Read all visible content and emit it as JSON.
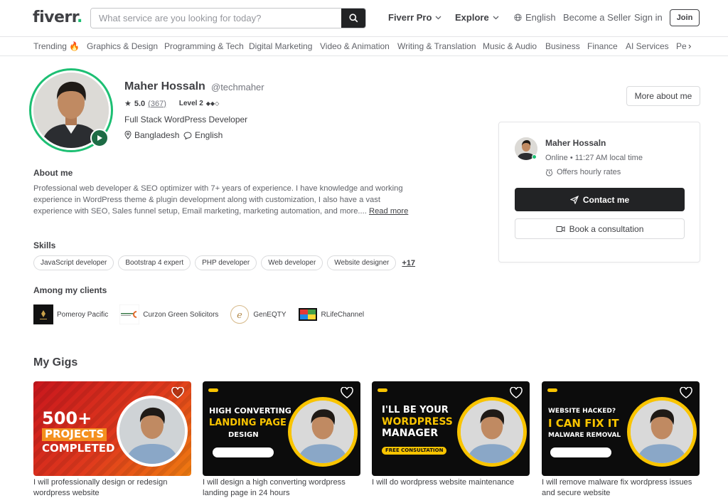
{
  "header": {
    "logo": "fiverr",
    "logo_dot": ".",
    "search_placeholder": "What service are you looking for today?",
    "fiverr_pro": "Fiverr Pro",
    "explore": "Explore",
    "language": "English",
    "become_seller": "Become a Seller",
    "sign_in": "Sign in",
    "join": "Join"
  },
  "categories": [
    "Trending 🔥",
    "Graphics & Design",
    "Programming & Tech",
    "Digital Marketing",
    "Video & Animation",
    "Writing & Translation",
    "Music & Audio",
    "Business",
    "Finance",
    "AI Services",
    "Personal Growth"
  ],
  "profile": {
    "name": "Maher Hossaln",
    "handle": "@techmaher",
    "rating": "5.0",
    "review_count": "(367)",
    "level": "Level 2",
    "level_diamonds": "◆◆◇",
    "title": "Full Stack WordPress Developer",
    "country": "Bangladesh",
    "language": "English",
    "more_about": "More about me"
  },
  "contact_card": {
    "name": "Maher Hossaln",
    "status": "Online • 11:27 AM local time",
    "hourly": "Offers hourly rates",
    "contact_btn": "Contact me",
    "consult_btn": "Book a consultation"
  },
  "about": {
    "heading": "About me",
    "text": "Professional web developer & SEO optimizer with 7+ years of experience. I have knowledge and working experience in WordPress theme & plugin development along with customization, I also have a vast experience with SEO, Sales funnel setup, Email marketing, marketing automation, and more.... ",
    "read_more": "Read more"
  },
  "skills": {
    "heading": "Skills",
    "items": [
      "JavaScript developer",
      "Bootstrap 4 expert",
      "PHP developer",
      "Web developer",
      "Website designer"
    ],
    "more": "+17"
  },
  "clients": {
    "heading": "Among my clients",
    "items": [
      "Pomeroy Pacific",
      "Curzon Green Solicitors",
      "GenEQTY",
      "RLifeChannel"
    ]
  },
  "gigs": {
    "heading": "My Gigs",
    "items": [
      {
        "title": "I will professionally design or redesign wordpress website",
        "banner": [
          "500+",
          "PROJECTS",
          "COMPLETED"
        ]
      },
      {
        "title": "I will design a high converting wordpress landing page in 24 hours",
        "banner": [
          "HIGH CONVERTING",
          "LANDING PAGE",
          "DESIGN"
        ]
      },
      {
        "title": "I will do wordpress website maintenance",
        "banner": [
          "I'LL BE YOUR",
          "WORDPRESS",
          "MANAGER",
          "FREE CONSULTATION"
        ]
      },
      {
        "title": "I will remove malware fix wordpress issues and secure website",
        "banner": [
          "WEBSITE HACKED?",
          "I CAN FIX IT",
          "MALWARE REMOVAL"
        ]
      }
    ]
  },
  "colors": {
    "brand_green": "#1dbf73",
    "dark": "#222325",
    "text": "#404145",
    "gig_yellow": "#f9c400",
    "gig_red": "#c8161d"
  }
}
